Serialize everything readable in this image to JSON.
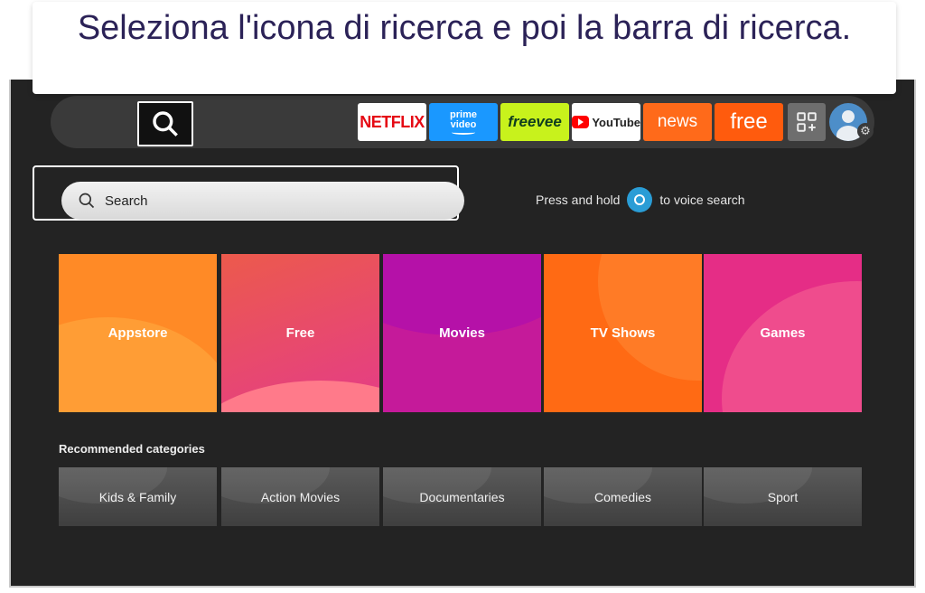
{
  "caption": "Seleziona l'icona di ricerca e poi la barra di ricerca.",
  "nav": {
    "icons": [
      "bookmark-icon",
      "gamepad-icon",
      "search-icon",
      "check-circle-icon",
      "home-icon",
      "live-tv-icon"
    ]
  },
  "apps": {
    "netflix": "NETFLIX",
    "prime_line1": "prime",
    "prime_line2": "video",
    "freevee": "freevee",
    "youtube": "YouTube",
    "news": "news",
    "free": "free"
  },
  "search": {
    "placeholder": "Search"
  },
  "voice": {
    "before": "Press and hold",
    "after": "to voice search"
  },
  "categories": [
    "Appstore",
    "Free",
    "Movies",
    "TV Shows",
    "Games"
  ],
  "recommended": {
    "title": "Recommended categories",
    "items": [
      "Kids & Family",
      "Action Movies",
      "Documentaries",
      "Comedies",
      "Sport"
    ]
  },
  "colors": {
    "appstore": "#ff8a26",
    "free": "#e43c88",
    "movies": "#c51a9a",
    "tv_shows": "#ff6a14",
    "games": "#e52d86",
    "background": "#232323"
  }
}
